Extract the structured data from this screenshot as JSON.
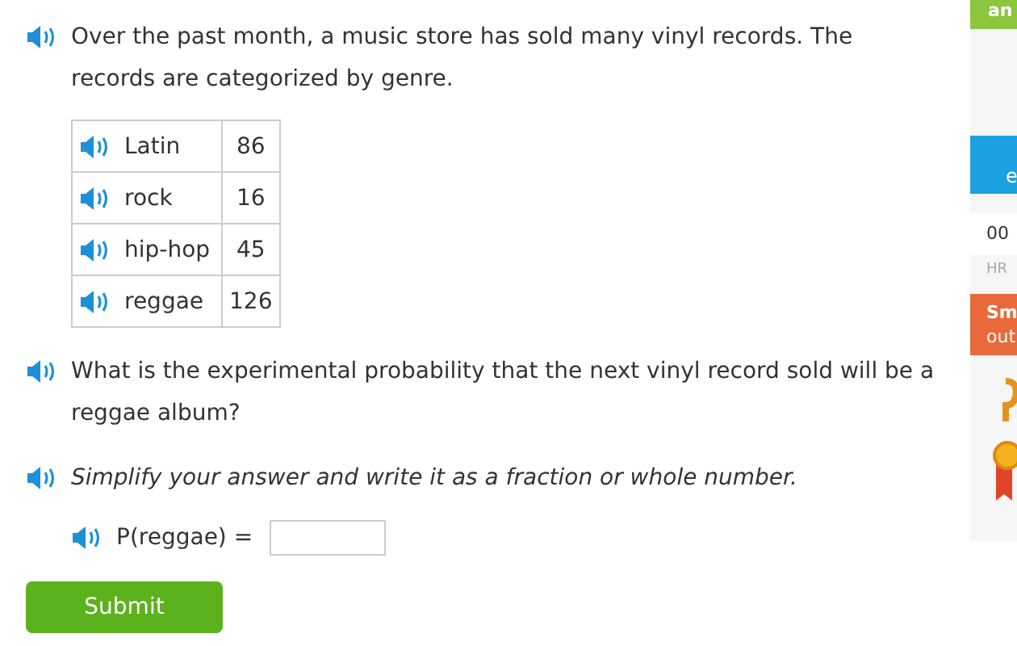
{
  "intro": "Over the past month, a music store has sold many vinyl records. The records are categorized by genre.",
  "table": {
    "rows": [
      {
        "genre": "Latin",
        "count": "86"
      },
      {
        "genre": "rock",
        "count": "16"
      },
      {
        "genre": "hip-hop",
        "count": "45"
      },
      {
        "genre": "reggae",
        "count": "126"
      }
    ]
  },
  "question": "What is the experimental probability that the next vinyl record sold will be a reggae album?",
  "instruction": "Simplify your answer and write it as a fraction or whole number.",
  "answer": {
    "label": "P(reggae) ="
  },
  "submit": "Submit",
  "sidebar": {
    "top_text": "an",
    "blue_text": "e",
    "timer": {
      "value": "00",
      "unit": "HR"
    },
    "orange_title": "Sm",
    "orange_sub": "out"
  }
}
